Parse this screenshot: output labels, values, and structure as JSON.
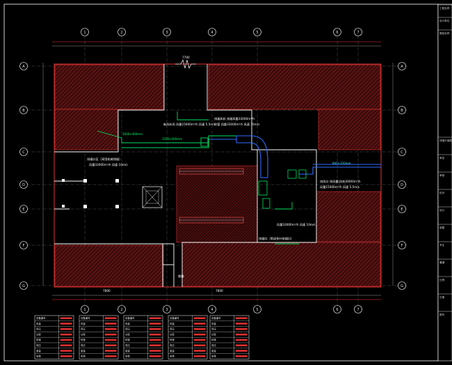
{
  "drawing": {
    "colors": {
      "background": "#000000",
      "wall": "#ff3b3b",
      "outline": "#ffffff",
      "duct_green": "#00e060",
      "duct_blue": "#2f6bff",
      "dimension": "#c0c0c0",
      "titleblock": "#e0e0e0"
    }
  },
  "annotations": {
    "top_dim": "7700",
    "room_label_left": "排烟分区（采用机械排烟）",
    "room_label_left_sub": "风量33000m³/h 风速 10m/s",
    "duct_note_1": "排烟风机 排烟风量33000m³/h",
    "duct_note_2": "新风补风 风量15000m³/h 风速 5.5m/s",
    "duct_note_3": "风管 风量33000m³/h 风速 10m/s",
    "duct_size_a": "1600×400mm",
    "duct_size_b": "1200×400mm",
    "duct_size_c": "800×320mm",
    "right_note_1": "排风口 排风量(风机)6000m³/h",
    "right_note_2": "风量15000m³/h 风速 5.5m/s",
    "lower_note": "风量33000m³/h 风速 10m/s",
    "bottom_note": "排烟口（常闭多叶排烟口）",
    "stair_label": "楼梯",
    "dim_left": "7800",
    "dim_right": "7800"
  },
  "grid_top": [
    "1",
    "2",
    "3",
    "4",
    "5",
    "6",
    "7"
  ],
  "grid_bottom": [
    "1",
    "2",
    "3",
    "4",
    "5",
    "6",
    "7"
  ],
  "grid_left": [
    "A",
    "B",
    "C",
    "D",
    "E",
    "F",
    "G"
  ],
  "grid_right": [
    "A",
    "B",
    "C",
    "D",
    "E",
    "F",
    "G"
  ],
  "tables": [
    {
      "rows": [
        "设备编号",
        "风量",
        "风压",
        "功率",
        "转速",
        "电压",
        "重量",
        "安装"
      ]
    },
    {
      "rows": [
        "设备编号",
        "风量",
        "风压",
        "功率",
        "转速",
        "电压",
        "重量",
        "安装"
      ]
    },
    {
      "rows": [
        "设备编号",
        "风量",
        "风压",
        "功率",
        "转速",
        "电压",
        "重量",
        "安装"
      ]
    },
    {
      "rows": [
        "设备编号",
        "风量",
        "风压",
        "功率",
        "转速",
        "电压",
        "重量",
        "安装"
      ]
    },
    {
      "rows": [
        "设备编号",
        "风量",
        "风压",
        "功率",
        "转速",
        "电压",
        "重量",
        "安装"
      ]
    }
  ],
  "titleblock": {
    "rows": [
      "工程名称",
      "设计单位",
      "图纸名称",
      "排烟平面图",
      "审定",
      "审核",
      "校对",
      "设计",
      "制图",
      "专业",
      "暖通",
      "比例",
      "日期",
      "图号"
    ]
  }
}
